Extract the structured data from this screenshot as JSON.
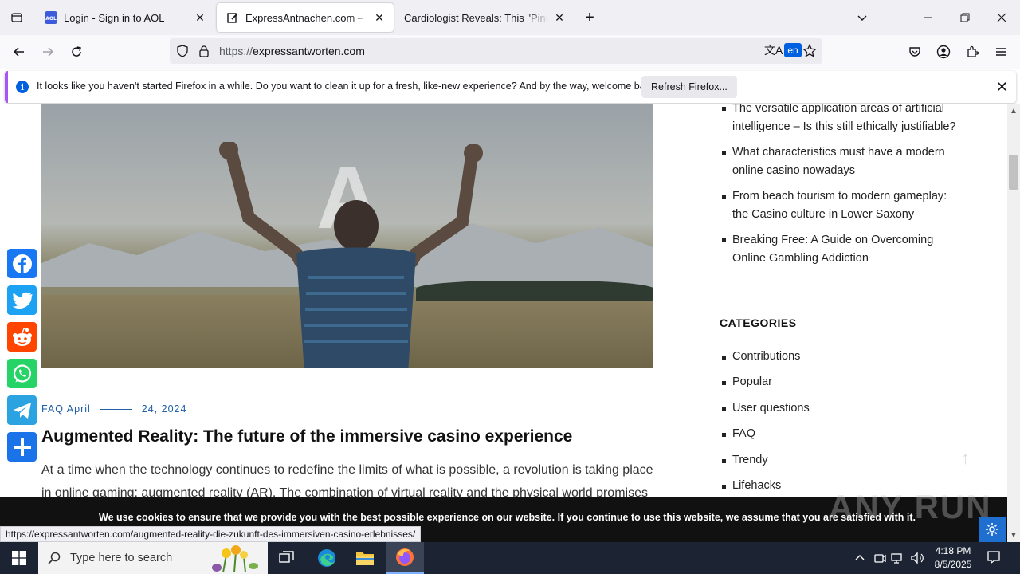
{
  "browser": {
    "tabs": [
      {
        "title": "Login - Sign in to AOL",
        "favicon": "aol-icon",
        "active": false
      },
      {
        "title": "ExpressAntnachen.com – The m",
        "favicon": "edit-document-icon",
        "active": true
      },
      {
        "title": "Cardiologist Reveals: This \"Pink Salt",
        "favicon": "none",
        "active": false
      }
    ],
    "url_protocol": "https://",
    "url_host": "expressantworten.com",
    "translate_lang": "en",
    "notification": {
      "message": "It looks like you haven't started Firefox in a while. Do you want to clean it up for a fresh, like-new experience? And by the way, welcome back!",
      "button": "Refresh Firefox..."
    },
    "status_url": "https://expressantworten.com/augmented-reality-die-zukunft-des-immersiven-casino-erlebnisses/"
  },
  "page": {
    "hero_letter": "A",
    "meta": {
      "category": "FAQ April",
      "date": "24, 2024"
    },
    "article_title": "Augmented Reality: The future of the immersive casino experience",
    "article_body": "At a time when the technology continues to redefine the limits of what is possible, a revolution is taking place in online gaming: augmented reality (AR). The combination of virtual reality and the physical world promises",
    "recent_posts": [
      "The versatile application areas of artificial intelligence – Is this still ethically justifiable?",
      "What characteristics must have a modern online casino nowadays",
      "From beach tourism to modern gameplay: the Casino culture in Lower Saxony",
      "Breaking Free: A Guide on Overcoming Online Gambling Addiction"
    ],
    "categories_heading": "CATEGORIES",
    "categories": [
      "Contributions",
      "Popular",
      "User questions",
      "FAQ",
      "Trendy",
      "Lifehacks"
    ],
    "cookie_text": "We use cookies to ensure that we provide you with the best possible experience on our website. If you continue to use this website, we assume that you are satisfied with it.",
    "watermark": "ANY RUN"
  },
  "taskbar": {
    "search_placeholder": "Type here to search",
    "time": "4:18 PM",
    "date": "8/5/2025"
  },
  "colors": {
    "accent_blue": "#1f5fa6",
    "firefox_blue": "#0061e0",
    "notify_border": "#a855f7",
    "facebook": "#1877f2",
    "twitter": "#1da1f2",
    "reddit": "#ff4500",
    "whatsapp": "#25d366",
    "telegram": "#2aa3e0",
    "share": "#1a73e8"
  }
}
